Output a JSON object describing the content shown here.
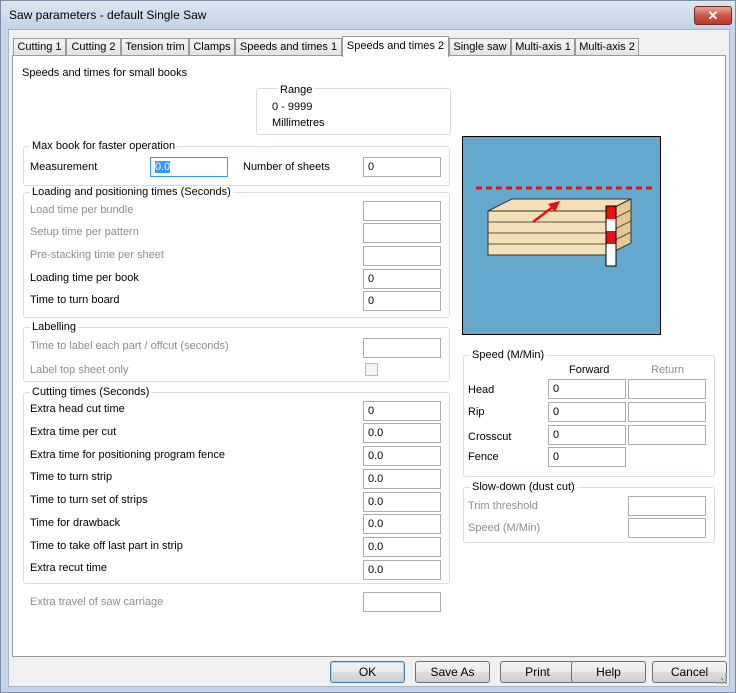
{
  "window": {
    "title": "Saw parameters - default Single Saw",
    "close_glyph": "✕"
  },
  "tabs": [
    "Cutting 1",
    "Cutting 2",
    "Tension trim",
    "Clamps",
    "Speeds and times 1",
    "Speeds and times 2",
    "Single saw",
    "Multi-axis 1",
    "Multi-axis 2"
  ],
  "active_tab": "Speeds and times 2",
  "heading": "Speeds and times for small books",
  "range": {
    "title": "Range",
    "values": "0 - 9999",
    "units": "Millimetres"
  },
  "max_book": {
    "title": "Max book for faster operation",
    "measurement_label": "Measurement",
    "measurement_value": "0.0",
    "sheets_label": "Number of sheets",
    "sheets_value": "0"
  },
  "loading": {
    "title": "Loading and positioning times (Seconds)",
    "rows": [
      {
        "label": "Load time per bundle",
        "value": ""
      },
      {
        "label": "Setup time per pattern",
        "value": ""
      },
      {
        "label": "Pre-stacking time per sheet",
        "value": ""
      },
      {
        "label": "Loading time per book",
        "value": "0"
      },
      {
        "label": "Time to turn board",
        "value": "0"
      }
    ]
  },
  "labelling": {
    "title": "Labelling",
    "part_label": "Time to label each part / offcut (seconds)",
    "part_value": "",
    "top_sheet_label": "Label top sheet only"
  },
  "cutting": {
    "title": "Cutting times (Seconds)",
    "rows": [
      {
        "label": "Extra head cut time",
        "value": "0"
      },
      {
        "label": "Extra time per cut",
        "value": "0.0"
      },
      {
        "label": "Extra time for positioning program fence",
        "value": "0.0"
      },
      {
        "label": "Time to turn strip",
        "value": "0.0"
      },
      {
        "label": "Time to turn set of strips",
        "value": "0.0"
      },
      {
        "label": "Time for drawback",
        "value": "0.0"
      },
      {
        "label": "Time to take off last part in strip",
        "value": "0.0"
      },
      {
        "label": "Extra recut time",
        "value": "0.0"
      }
    ]
  },
  "extra_travel": {
    "label": "Extra travel of saw carriage",
    "value": ""
  },
  "speed": {
    "title": "Speed (M/Min)",
    "forward_label": "Forward",
    "return_label": "Return",
    "rows": [
      {
        "label": "Head",
        "forward": "0",
        "return": ""
      },
      {
        "label": "Rip",
        "forward": "0",
        "return": ""
      },
      {
        "label": "Crosscut",
        "forward": "0",
        "return": ""
      },
      {
        "label": "Fence",
        "forward": "0"
      }
    ]
  },
  "slowdown": {
    "title": "Slow-down (dust cut)",
    "trim_label": "Trim threshold",
    "trim_value": "",
    "speed_label": "Speed (M/Min)",
    "speed_value": ""
  },
  "buttons": {
    "ok": "OK",
    "save_as": "Save As",
    "print": "Print",
    "help": "Help",
    "cancel": "Cancel"
  },
  "colors": {
    "illustration_bg": "#64a9cd",
    "board": "#f3dfb8",
    "cut_line": "#e81010"
  }
}
